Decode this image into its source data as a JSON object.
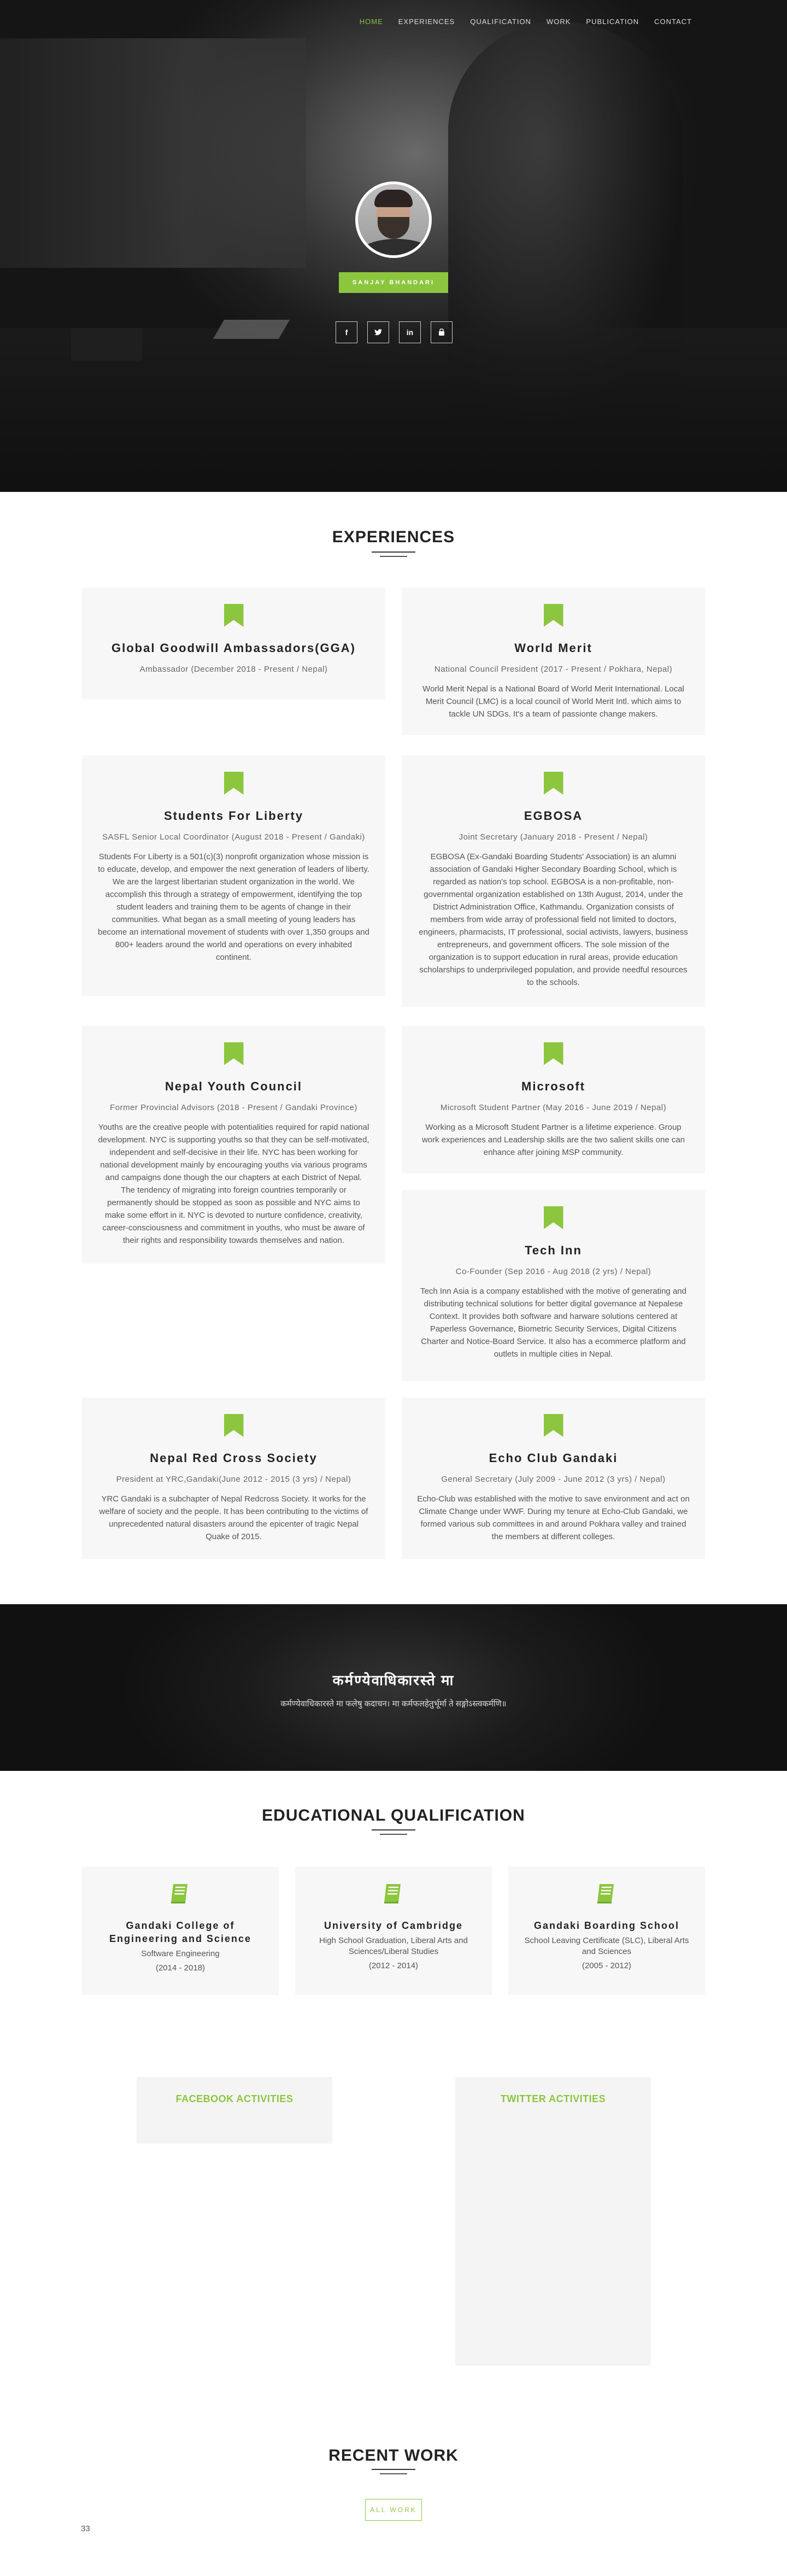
{
  "nav": [
    "HOME",
    "EXPERIENCES",
    "QUALIFICATION",
    "WORK",
    "PUBLICATION",
    "CONTACT"
  ],
  "profile": {
    "name": "SANJAY BHANDARI",
    "socials": [
      "f",
      "t",
      "in",
      "yt"
    ]
  },
  "colors": {
    "accent": "#8cc63f",
    "dark": "#222222",
    "card_bg": "#f7f7f7"
  },
  "experiences_title": "EXPERIENCES",
  "experiences": [
    {
      "title": "Global Goodwill Ambassadors(GGA)",
      "role": "Ambassador (December 2018 - Present / Nepal)",
      "desc": ""
    },
    {
      "title": "World Merit",
      "role": "National Council President (2017 - Present / Pokhara, Nepal)",
      "desc": "World Merit Nepal is a National Board of World Merit International. Local Merit Council (LMC) is a local council of World Merit Intl. which aims to tackle UN SDGs. It's a team of passionte change makers."
    },
    {
      "title": "Students For Liberty",
      "role": "SASFL Senior Local Coordinator (August 2018 - Present / Gandaki)",
      "desc": "Students For Liberty is a 501(c)(3) nonprofit organization whose mission is to educate, develop, and empower the next generation of leaders of liberty. We are the largest libertarian student organization in the world. We accomplish this through a strategy of empowerment, identifying the top student leaders and training them to be agents of change in their communities. What began as a small meeting of young leaders has become an international movement of students with over 1,350 groups and 800+ leaders around the world and operations on every inhabited continent."
    },
    {
      "title": "EGBOSA",
      "role": "Joint Secretary (January 2018 - Present / Nepal)",
      "desc": "EGBOSA (Ex-Gandaki Boarding Students' Association) is an alumni association of Gandaki Higher Secondary Boarding School, which is regarded as nation's top school. EGBOSA is a non-profitable, non-governmental organization established on 13th August, 2014, under the District Administration Office, Kathmandu. Organization consists of members from wide array of professional field not limited to doctors, engineers, pharmacists, IT professional, social activists, lawyers, business entrepreneurs, and government officers. The sole mission of the organization is to support education in rural areas, provide education scholarships to underprivileged population, and provide needful resources to the schools."
    },
    {
      "title": "Nepal Youth Council",
      "role": "Former Provincial Advisors (2018 - Present / Gandaki Province)",
      "desc": "Youths are the creative people with potentialities required for rapid national development. NYC is supporting youths so that they can be self-motivated, independent and self-decisive in their life. NYC has been working for national development mainly by encouraging youths via various programs and campaigns done though the our chapters at each District of Nepal. The tendency of migrating into foreign countries temporarily or permanently should be stopped as soon as possible and NYC aims to make some effort in it. NYC is devoted to nurture confidence, creativity, career-consciousness and commitment in youths, who must be aware of their rights and responsibility towards themselves and nation."
    },
    {
      "title": "Microsoft",
      "role": "Microsoft Student Partner (May 2016 - June 2019 / Nepal)",
      "desc": "Working as a Microsoft Student Partner is a lifetime experience. Group work experiences and Leadership skills are the two salient skills one can enhance after joining MSP community."
    },
    {
      "title": "Tech Inn",
      "role": "Co-Founder (Sep 2016 - Aug 2018 (2 yrs) / Nepal)",
      "desc": "Tech Inn Asia is a company established with the motive of generating and distributing technical solutions for better digital governance at Nepalese Context. It provides both software and harware solutions centered at Paperless Governance, Biometric Security Services, Digital Citizens Charter and Notice-Board Service. It also has a ecommerce platform and outlets in multiple cities in Nepal."
    },
    {
      "title": "Nepal Red Cross Society",
      "role": "President at YRC,Gandaki(June 2012 - 2015 (3 yrs) / Nepal)",
      "desc": "YRC Gandaki is a subchapter of Nepal Redcross Society. It works for the welfare of society and the people. It has been contributing to the victims of unprecedented natural disasters around the epicenter of tragic Nepal Quake of 2015."
    },
    {
      "title": "Echo Club Gandaki",
      "role": "General Secretary (July 2009 - June 2012 (3 yrs) / Nepal)",
      "desc": "Echo-Club was established with the motive to save environment and act on Climate Change under WWF. During my tenure at Echo-Club Gandaki, we formed various sub committees in and around Pokhara valley and trained the members at different colleges."
    }
  ],
  "quote": {
    "heading": "कर्मण्येवाधिकारस्ते मा",
    "text": "कर्मण्येवाधिकारस्ते मा फलेषु कदाचन। मा कर्मफलहेतुर्भूर्मा ते सङ्गोऽस्त्वकर्मणि॥"
  },
  "education_title": "EDUCATIONAL QUALIFICATION",
  "education": [
    {
      "school": "Gandaki College of Engineering and Science",
      "degree": "Software Engineering",
      "years": "(2014 - 2018)"
    },
    {
      "school": "University of Cambridge",
      "degree": "High School Graduation, Liberal Arts and Sciences/Liberal Studies",
      "years": "(2012 - 2014)"
    },
    {
      "school": "Gandaki Boarding School",
      "degree": "School Leaving Certificate (SLC), Liberal Arts and Sciences",
      "years": "(2005 - 2012)"
    }
  ],
  "feeds": {
    "facebook": "FACEBOOK ACTIVITIES",
    "twitter": "TWITTER ACTIVITIES"
  },
  "work": {
    "title": "RECENT WORK",
    "all_button": "ALL WORK",
    "count": "33"
  }
}
